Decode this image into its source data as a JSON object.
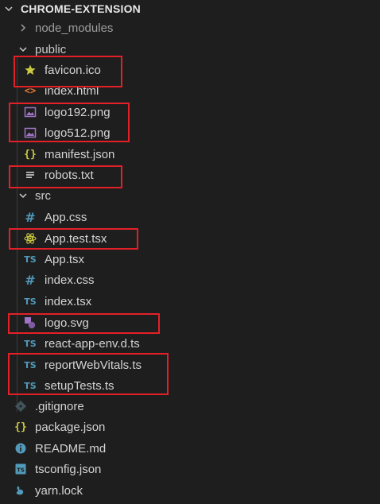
{
  "explorer": {
    "root_label": "CHROME-EXTENSION",
    "node_modules": "node_modules",
    "public": {
      "label": "public",
      "files": [
        "favicon.ico",
        "index.html",
        "logo192.png",
        "logo512.png",
        "manifest.json",
        "robots.txt"
      ]
    },
    "src": {
      "label": "src",
      "files": [
        "App.css",
        "App.test.tsx",
        "App.tsx",
        "index.css",
        "index.tsx",
        "logo.svg",
        "react-app-env.d.ts",
        "reportWebVitals.ts",
        "setupTests.ts"
      ]
    },
    "root_files": [
      ".gitignore",
      "package.json",
      "README.md",
      "tsconfig.json",
      "yarn.lock"
    ]
  },
  "icon_glyphs": {
    "ts": "TS",
    "css": "#",
    "json": "{}",
    "html": "<>"
  },
  "colors": {
    "background": "#1e1e1e",
    "text": "#d4d4d4",
    "highlight_border": "#e32028",
    "ts_blue": "#519aba",
    "json_yellow": "#cbcb41",
    "html_orange": "#e37933",
    "svg_purple": "#a074c4",
    "star_yellow": "#cbcb41"
  },
  "highlighted_items": [
    "favicon.ico",
    "logo192.png",
    "logo512.png",
    "robots.txt",
    "App.test.tsx",
    "logo.svg",
    "reportWebVitals.ts",
    "setupTests.ts"
  ]
}
